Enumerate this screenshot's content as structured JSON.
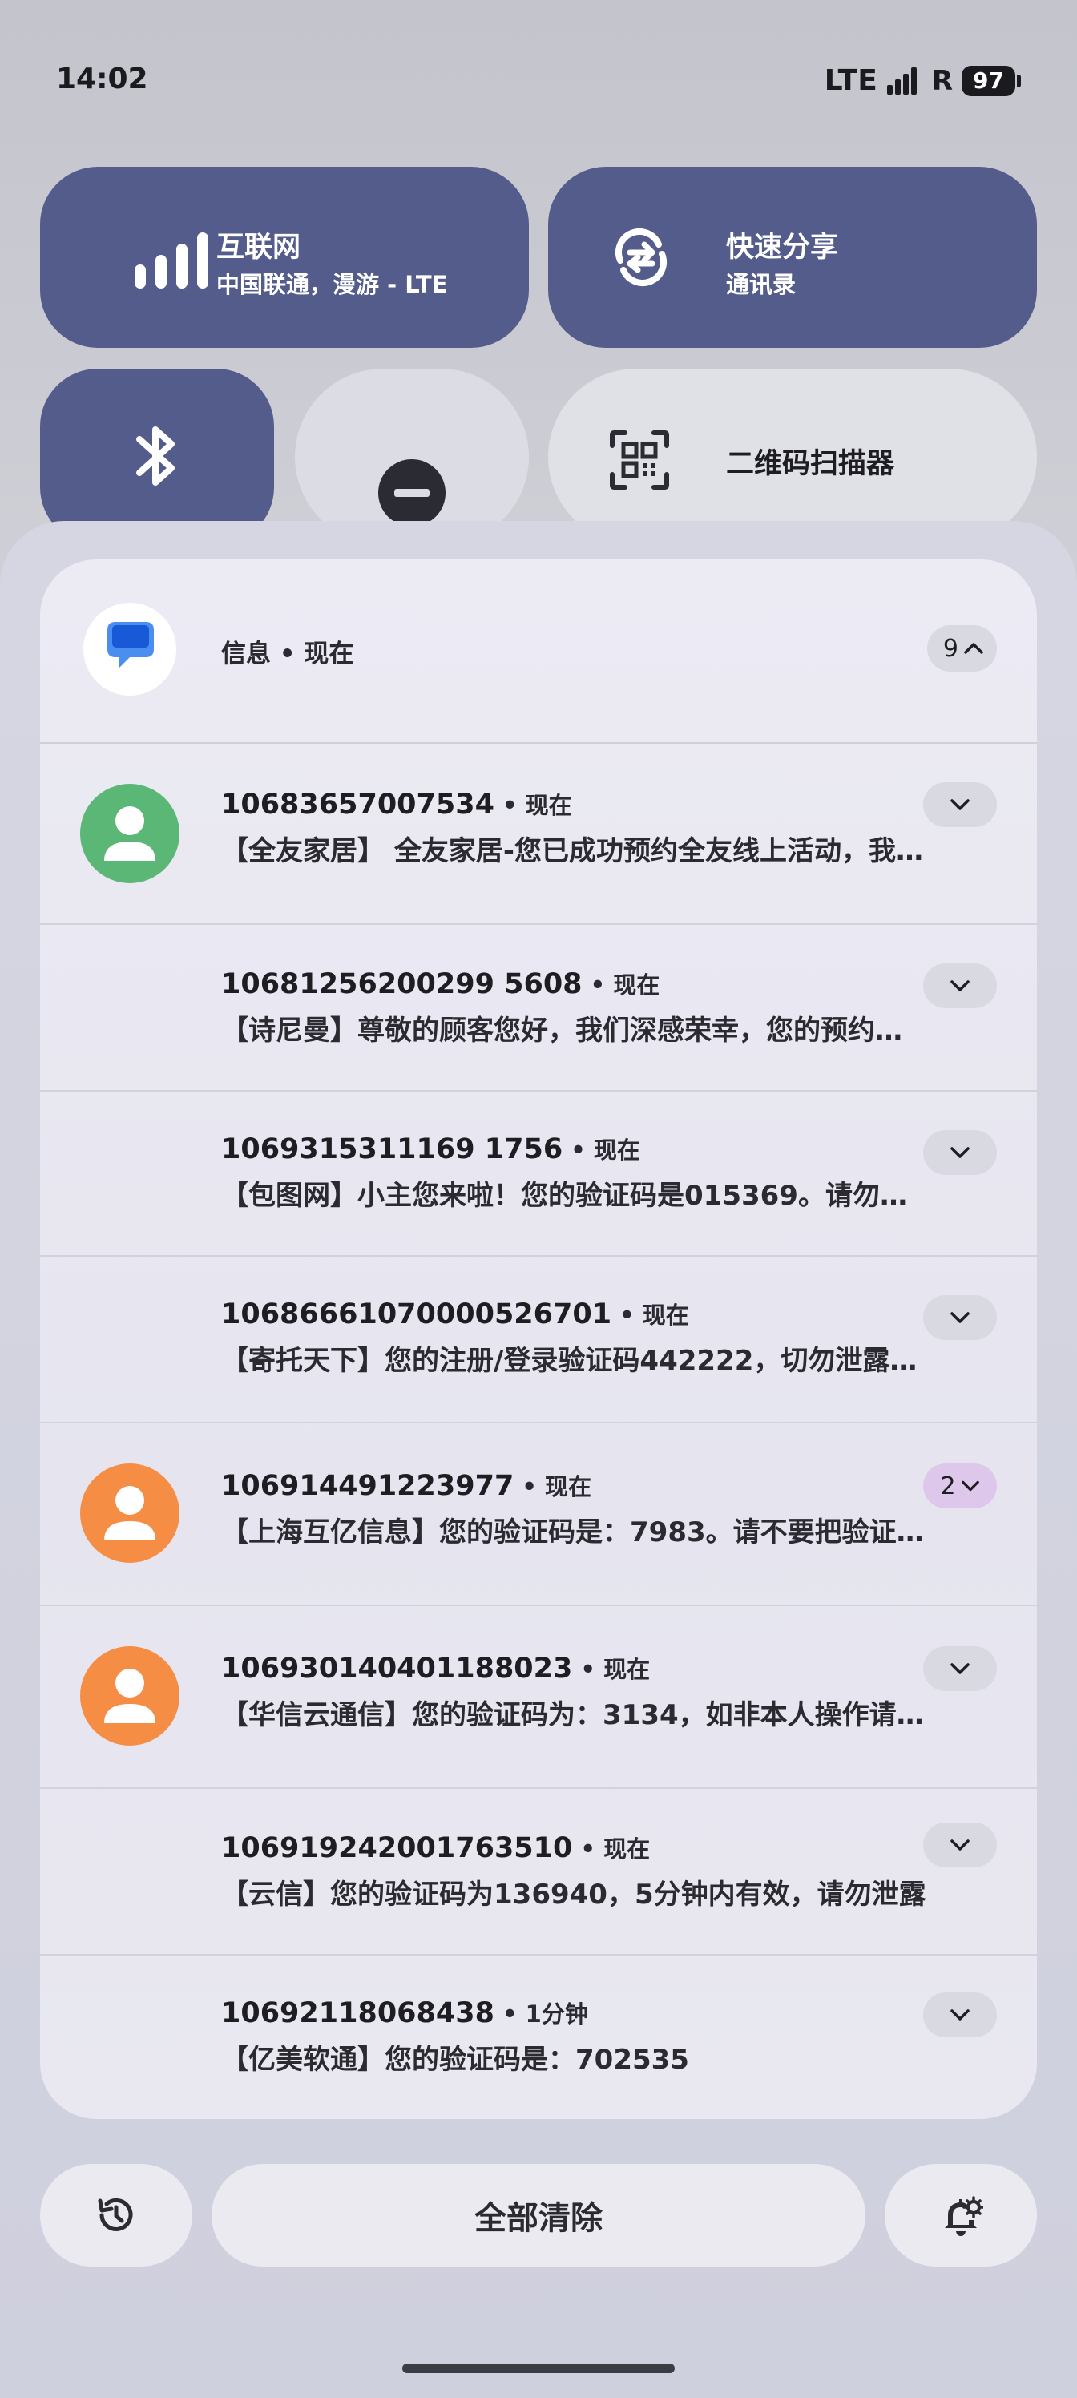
{
  "status_bar": {
    "time": "14:02",
    "network": "LTE",
    "roaming": "R",
    "battery": "97"
  },
  "tiles": {
    "internet": {
      "title": "互联网",
      "subtitle": "中国联通，漫游 - LTE",
      "icon": "signal-icon"
    },
    "quick_share": {
      "title": "快速分享",
      "subtitle": "通讯录",
      "icon": "quick-share-icon"
    },
    "bluetooth": {
      "icon": "bluetooth-icon"
    },
    "dnd": {
      "icon": "do-not-disturb-icon"
    },
    "qr": {
      "title": "二维码扫描器",
      "icon": "qr-scan-icon"
    }
  },
  "notification_group": {
    "app": "信息 • 现在",
    "count": "9",
    "items": [
      {
        "sender": "10683657007534",
        "time": " • 现在",
        "message": "【全友家居】 全友家居-您已成功预约全友线上活动，我们的工作人员将尽快与您联系",
        "avatar": "green",
        "badge": ""
      },
      {
        "sender": "10681256200299 5608",
        "time": " • 现在",
        "message": "【诗尼曼】尊敬的顾客您好，我们深感荣幸，您的预约已提交成功",
        "avatar": "",
        "badge": ""
      },
      {
        "sender": "1069315311169 1756",
        "time": " • 现在",
        "message": "【包图网】小主您来啦！您的验证码是015369。请勿泄露",
        "avatar": "",
        "badge": ""
      },
      {
        "sender": "10686661070000526701",
        "time": " • 现在",
        "message": "【寄托天下】您的注册/登录验证码442222，切勿泄露给他人",
        "avatar": "",
        "badge": ""
      },
      {
        "sender": "106914491223977",
        "time": " • 现在",
        "message": "【上海互亿信息】您的验证码是：7983。请不要把验证码泄露给其他人",
        "avatar": "orange",
        "badge": "2"
      },
      {
        "sender": "106930140401188023",
        "time": " • 现在",
        "message": "【华信云通信】您的验证码为：3134，如非本人操作请忽略",
        "avatar": "orange",
        "badge": ""
      },
      {
        "sender": "106919242001763510",
        "time": " • 现在",
        "message": "【云信】您的验证码为136940，5分钟内有效，请勿泄露",
        "avatar": "",
        "badge": ""
      },
      {
        "sender": "10692118068438",
        "time": " • 1分钟",
        "message": "【亿美软通】您的验证码是：702535",
        "avatar": "",
        "badge": ""
      }
    ]
  },
  "actions": {
    "clear_all": "全部清除",
    "history_icon": "history-icon",
    "settings_icon": "notification-settings-icon"
  }
}
